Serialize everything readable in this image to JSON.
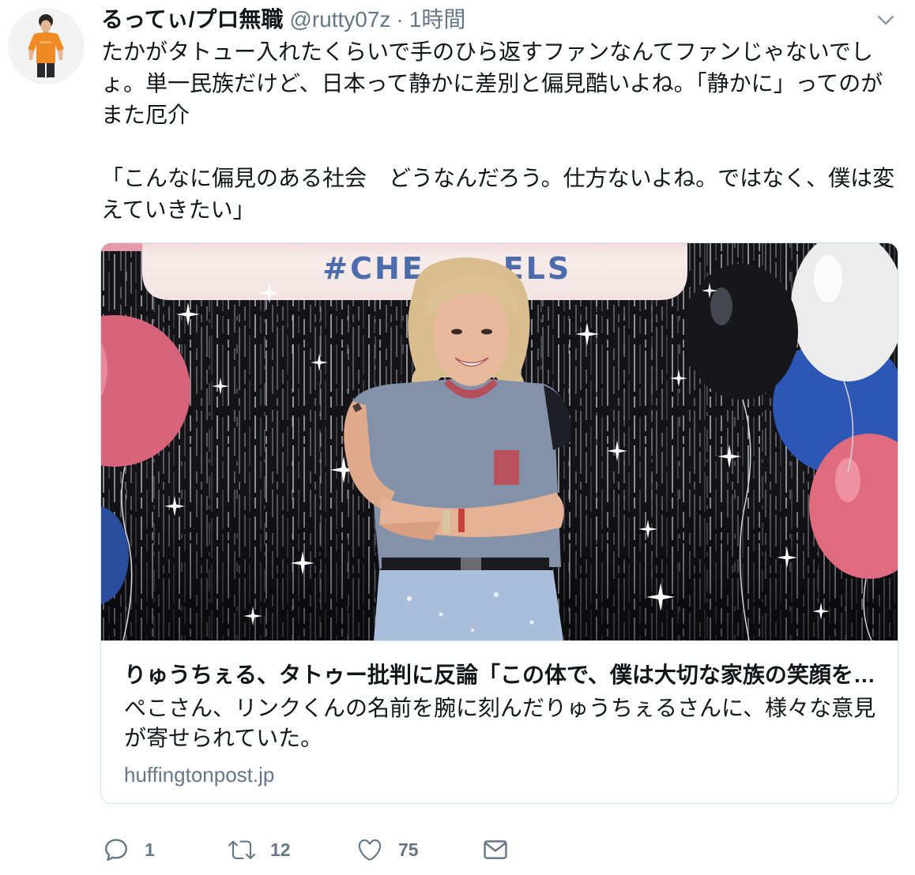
{
  "tweet": {
    "author": {
      "name": "るってぃ/プロ無職",
      "handle": "@rutty07z",
      "separator": "·",
      "time": "1時間"
    },
    "text": [
      "たかがタトュー入れたくらいで手のひら返すファンなんてファンじゃないでしょ。単一民族だけど、日本って静かに差別と偏見酷いよね。「静かに」ってのがまた厄介",
      "「こんなに偏見のある社会　どうなんだろう。仕方ないよね。ではなく、僕は変えていきたい」"
    ],
    "card": {
      "image": {
        "banner_text": [
          "#CHE",
          "ELS"
        ]
      },
      "title": "りゅうちぇる、タトゥー批判に反論「この体で、僕は大切な家族の笑顔を…",
      "description": "ぺこさん、リンクくんの名前を腕に刻んだりゅうちぇるさんに、様々な意見が寄せられていた。",
      "domain": "huffingtonpost.jp"
    },
    "actions": {
      "reply": {
        "icon": "reply-icon",
        "count": "1"
      },
      "retweet": {
        "icon": "retweet-icon",
        "count": "12"
      },
      "like": {
        "icon": "heart-icon",
        "count": "75"
      },
      "direct_message": {
        "icon": "envelope-icon"
      }
    },
    "menu": {
      "icon": "chevron-down-icon"
    }
  },
  "colors": {
    "primary_text": "#14171a",
    "secondary_text": "#657786",
    "card_border": "#e1e8ed",
    "avatar_shirt": "#f08a24"
  }
}
